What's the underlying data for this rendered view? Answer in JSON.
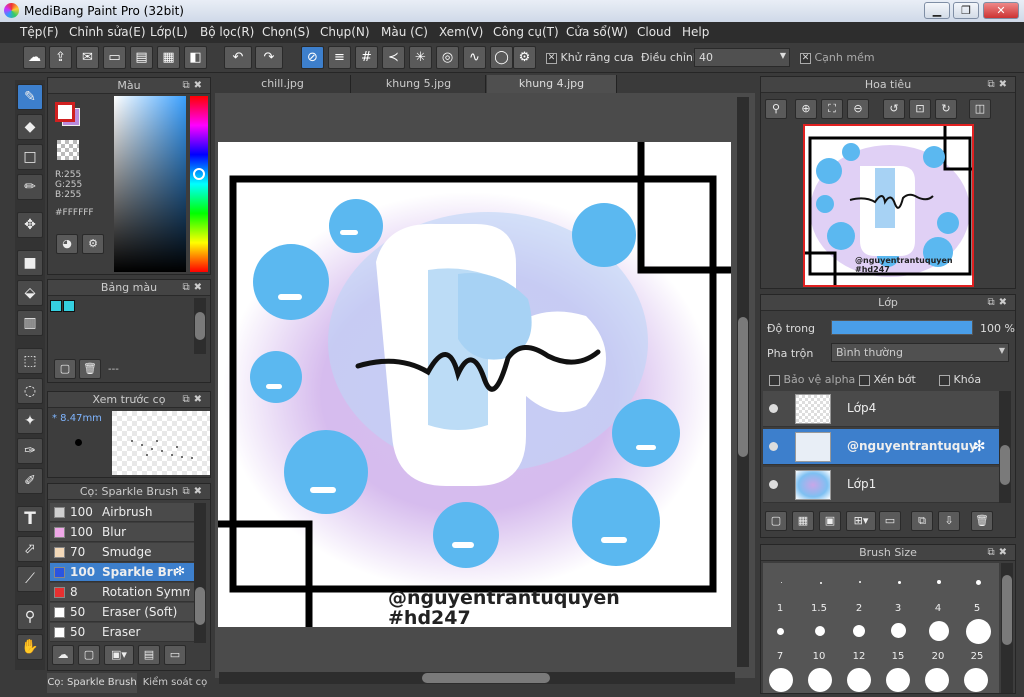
{
  "window": {
    "title": "MediBang Paint Pro (32bit)",
    "minimize": "▁",
    "maximize": "❐",
    "close": "✕"
  },
  "menu": [
    "Tệp(F)",
    "Chỉnh sửa(E)",
    "Lớp(L)",
    "Bộ lọc(R)",
    "Chọn(S)",
    "Chụp(N)",
    "Màu (C)",
    "Xem(V)",
    "Công cụ(T)",
    "Cửa sổ(W)",
    "Cloud",
    "Help"
  ],
  "toolbar": {
    "antialias_label": "Khử răng cưa",
    "adjust_label": "Điều chỉnh",
    "adjust_value": "40",
    "edge_label": "Cạnh mềm",
    "check": "✕"
  },
  "color_panel": {
    "title": "Màu",
    "r": "R:255",
    "g": "G:255",
    "b": "B:255",
    "hex": "#FFFFFF",
    "primary": "#ffffff",
    "secondary": "#b98bdc",
    "accent": "#3d7fcc"
  },
  "palette_panel": {
    "title": "Bảng màu",
    "swatch": "#35d0e0",
    "dash": "---"
  },
  "brush_preview": {
    "title": "Xem trước cọ",
    "size": "* 8.47mm"
  },
  "brush_panel": {
    "title": "Cọ: Sparkle Brush",
    "items": [
      {
        "n": "100",
        "name": "Airbrush",
        "color": "#cfcfcf"
      },
      {
        "n": "100",
        "name": "Blur",
        "color": "#f0a8e8"
      },
      {
        "n": "70",
        "name": "Smudge",
        "color": "#f3d9b8"
      },
      {
        "n": "100",
        "name": "Sparkle Brush",
        "color": "#2a55e0"
      },
      {
        "n": "8",
        "name": "Rotation Symmetry",
        "color": "#e83030"
      },
      {
        "n": "50",
        "name": "Eraser (Soft)",
        "color": "#ffffff"
      },
      {
        "n": "50",
        "name": "Eraser",
        "color": "#ffffff"
      }
    ],
    "bottom_tabs": [
      "Cọ: Sparkle Brush",
      "Kiểm soát cọ"
    ]
  },
  "tabs": [
    "chill.jpg",
    "khung 5.jpg",
    "khung 4.jpg"
  ],
  "canvas": {
    "watermark1": "@nguyentrantuquyen",
    "watermark2": "#hd247",
    "bubble": "#5bb8f0",
    "mist": "#c9a6e8"
  },
  "navigator": {
    "title": "Hoa tiêu",
    "wm1": "@nguyentrantuquyen",
    "wm2": "#hd247"
  },
  "layer_panel": {
    "title": "Lớp",
    "opacity_label": "Độ trong",
    "opacity_value": "100 %",
    "opacity": 1.0,
    "blend_label": "Pha trộn",
    "blend_value": "Bình thường",
    "protect_alpha": "Bảo vệ alpha",
    "clip": "Xén bớt",
    "lock": "Khóa",
    "layers": [
      {
        "name": "Lớp4"
      },
      {
        "name": "@nguyentrantuquyen"
      },
      {
        "name": "Lớp1"
      }
    ]
  },
  "brush_size": {
    "title": "Brush Size",
    "row1": [
      "1",
      "1.5",
      "2",
      "3",
      "4",
      "5"
    ],
    "row2": [
      "7",
      "10",
      "12",
      "15",
      "20",
      "25"
    ]
  }
}
